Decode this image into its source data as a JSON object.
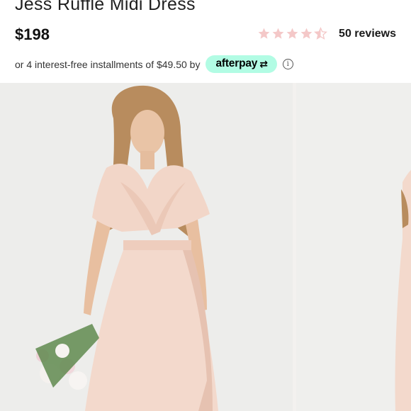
{
  "product": {
    "title": "Jess Ruffle Midi Dress",
    "price": "$198"
  },
  "rating": {
    "stars": 4.5,
    "max_stars": 5,
    "reviews_label": "50 reviews",
    "star_color": "#f4c8c8"
  },
  "installments": {
    "text": "or 4 interest-free installments of $49.50 by",
    "provider": "afterpay",
    "provider_symbol": "⇄",
    "badge_color": "#b2fce4",
    "info_symbol": "i"
  },
  "gallery": {
    "images": [
      {
        "name": "model-front-photo"
      },
      {
        "name": "model-side-photo"
      }
    ],
    "dress_color": "#f3d9cc"
  }
}
